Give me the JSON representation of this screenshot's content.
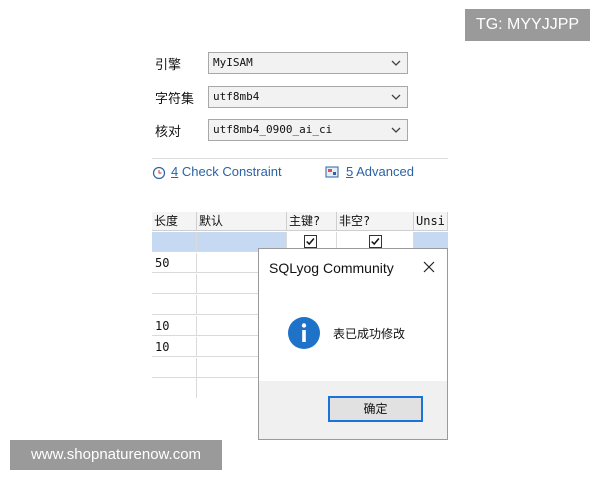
{
  "watermarks": {
    "top": "TG: MYYJJPP",
    "bottom": "www.shopnaturenow.com"
  },
  "options": {
    "engine": {
      "label": "引擎",
      "value": "MyISAM"
    },
    "charset": {
      "label": "字符集",
      "value": "utf8mb4"
    },
    "collation": {
      "label": "核对",
      "value": "utf8mb4_0900_ai_ci"
    }
  },
  "tabs": [
    {
      "number": "4",
      "label": "Check Constraint",
      "icon": "check-constraint-icon"
    },
    {
      "number": "5",
      "label": "Advanced",
      "icon": "advanced-icon"
    }
  ],
  "grid": {
    "headers": [
      "长度",
      "默认",
      "主键?",
      "非空?",
      "Unsi"
    ],
    "rows": [
      {
        "length": "",
        "pk": true,
        "notnull": true
      },
      {
        "length": "50"
      },
      {
        "length": ""
      },
      {
        "length": ""
      },
      {
        "length": "10"
      },
      {
        "length": "10"
      },
      {
        "length": ""
      },
      {
        "length": ""
      }
    ]
  },
  "dialog": {
    "title": "SQLyog Community",
    "message": "表已成功修改",
    "ok_label": "确定",
    "icon": "info-icon",
    "accent": "#1a73d9"
  }
}
